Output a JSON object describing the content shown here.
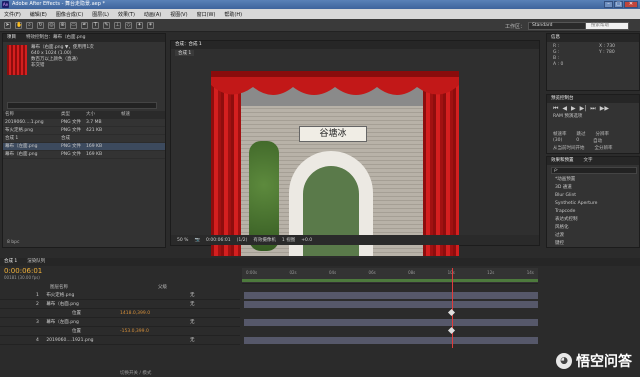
{
  "app": {
    "title": "Adobe After Effects - 舞台走隐景.aep *",
    "icon": "Ae"
  },
  "window_buttons": [
    "–",
    "□",
    "✕"
  ],
  "menu": [
    "文件(F)",
    "编辑(E)",
    "图像合成(C)",
    "图层(L)",
    "效果(T)",
    "动画(A)",
    "视图(V)",
    "窗口(W)",
    "帮助(H)"
  ],
  "workspace": {
    "label": "工作区：",
    "value": "Standard",
    "search_placeholder": "搜索帮助"
  },
  "project": {
    "tabs": [
      "项目",
      "特效控制台：幕布（右面.png"
    ],
    "selected_name": "幕布（右面.png ▼，使用用1次",
    "info": [
      "640 x 1024 (1.00)",
      "数百万以上颜色（直通）",
      "非交错"
    ],
    "search_placeholder": "",
    "columns": [
      "名称",
      "",
      "类型",
      "大小",
      "帧速"
    ],
    "items": [
      {
        "name": "2019060....1.png",
        "type": "PNG 文件",
        "size": "3.7 MB"
      },
      {
        "name": "布火定格.png",
        "type": "PNG 文件",
        "size": "421 KB"
      },
      {
        "name": "合成 1",
        "type": "合成",
        "size": ""
      },
      {
        "name": "幕布（左面.png",
        "type": "PNG 文件",
        "size": "169 KB"
      },
      {
        "name": "幕布（右面.png",
        "type": "PNG 文件",
        "size": "169 KB"
      }
    ],
    "bpc": "8 bpc"
  },
  "comp": {
    "tabs": [
      "合成：合成 1"
    ],
    "sub_tab": "合成 1",
    "sign_text": "谷塘冰",
    "zoom": "50 %",
    "timecode": "0:00:06:01",
    "resolution": "(1/2)",
    "camera": "有效摄像机",
    "views": "1 视图",
    "offset": "+0.0"
  },
  "info_panel": {
    "tabs": [
      "信息"
    ],
    "rgba": [
      "R :",
      "G :",
      "B :",
      "A : 0"
    ],
    "coords": [
      "X : 730",
      "Y : 780"
    ]
  },
  "preview": {
    "title": "预览控制台",
    "ram": "RAM 预演选项",
    "labels": [
      "帧速率",
      "跳过",
      "分辨率"
    ],
    "values": [
      "(30)",
      "0",
      "自动"
    ],
    "options": [
      "从当前时间开始",
      "全分辨率"
    ]
  },
  "effects": {
    "tabs": [
      "效果和预置",
      "文字"
    ],
    "search": "ρ·",
    "items": [
      "*动画预置",
      "3D 通道",
      "Blur Glint",
      "Synthetic Aperture",
      "Trapcode",
      "表达式控制",
      "风格化",
      "过渡",
      "键控"
    ]
  },
  "paragraph": {
    "title": "段落",
    "vals": [
      "0 px",
      "0 px",
      "0 px",
      "0 px",
      "0 px"
    ]
  },
  "timeline": {
    "tabs": [
      "合成 1",
      "渲染队列"
    ],
    "timecode": "0:00:06:01",
    "frame_info": "00181 (30.00 fps)",
    "col_header": [
      "图层名称",
      "父级"
    ],
    "ruler": [
      "0:00s",
      "02s",
      "04s",
      "06s",
      "08s",
      "10s",
      "12s",
      "14s"
    ],
    "layers": [
      {
        "num": "1",
        "name": "布火定格.png",
        "parent": "无"
      },
      {
        "num": "2",
        "name": "幕布（右面.png",
        "parent": "无"
      },
      {
        "num": "",
        "name": "位置",
        "value": "1418.0,399.0"
      },
      {
        "num": "3",
        "name": "幕布（左面.png",
        "parent": "无"
      },
      {
        "num": "",
        "name": "位置",
        "value": "-153.0,399.0"
      },
      {
        "num": "4",
        "name": "2019060....1921.png",
        "parent": "无"
      }
    ],
    "footer": "切换开关 / 模式"
  },
  "watermark": {
    "text": "悟空问答",
    "icon": "wukong-logo"
  }
}
